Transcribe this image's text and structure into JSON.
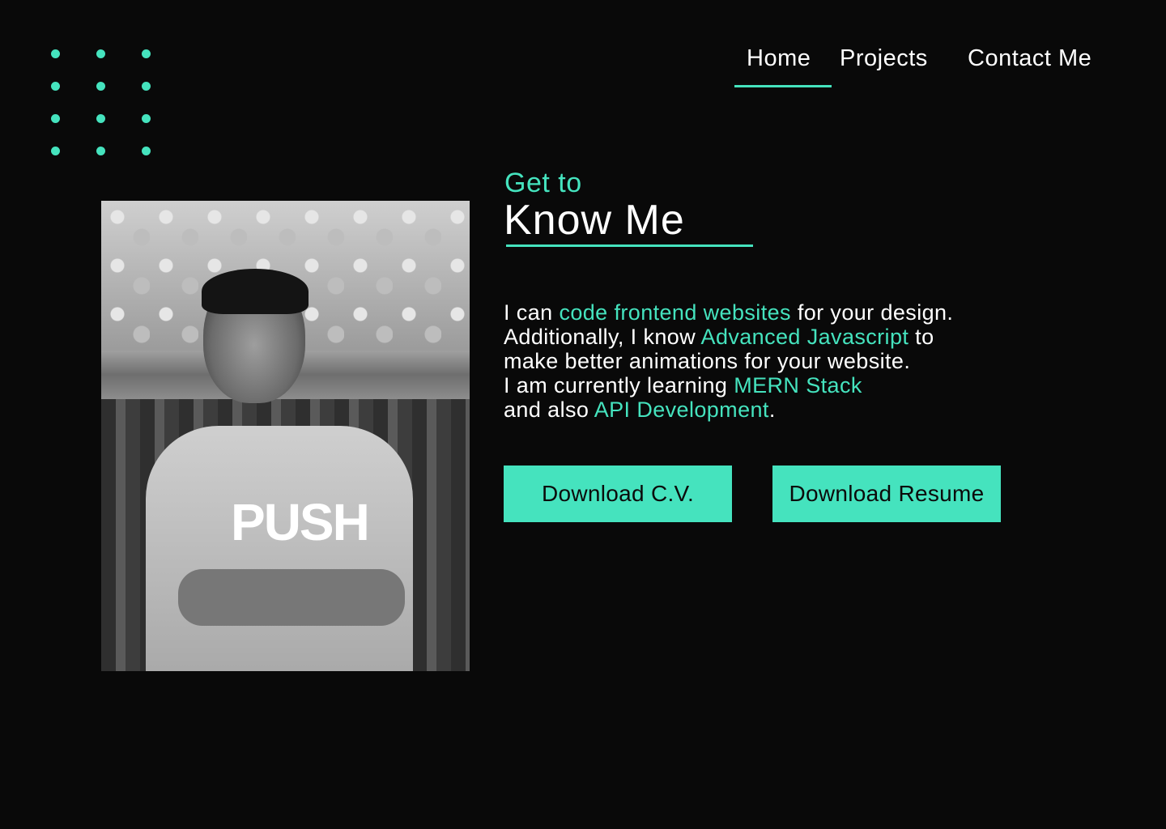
{
  "nav": {
    "items": [
      {
        "label": "Home",
        "active": true
      },
      {
        "label": "Projects",
        "active": false
      },
      {
        "label": "Contact Me",
        "active": false
      }
    ]
  },
  "photo": {
    "shirt_text": "PUSH"
  },
  "about": {
    "heading_small": "Get to",
    "heading_big": "Know Me",
    "lines": [
      {
        "before": "I can ",
        "highlight": "code frontend websites",
        "after": " for your design."
      },
      {
        "before": "Additionally, I know ",
        "highlight": "Advanced Javascript",
        "after": " to"
      },
      {
        "before": "make better animations for your website.",
        "highlight": "",
        "after": ""
      },
      {
        "before": "I am currently learning ",
        "highlight": "MERN Stack",
        "after": ""
      },
      {
        "before": "and also ",
        "highlight": "API Development",
        "after": "."
      }
    ]
  },
  "buttons": {
    "cv_label": "Download C.V.",
    "resume_label": "Download Resume"
  },
  "colors": {
    "background": "#090909",
    "accent": "#45e3be",
    "text": "#ffffff"
  },
  "icons": {
    "decoration": "dot-grid-icon"
  }
}
